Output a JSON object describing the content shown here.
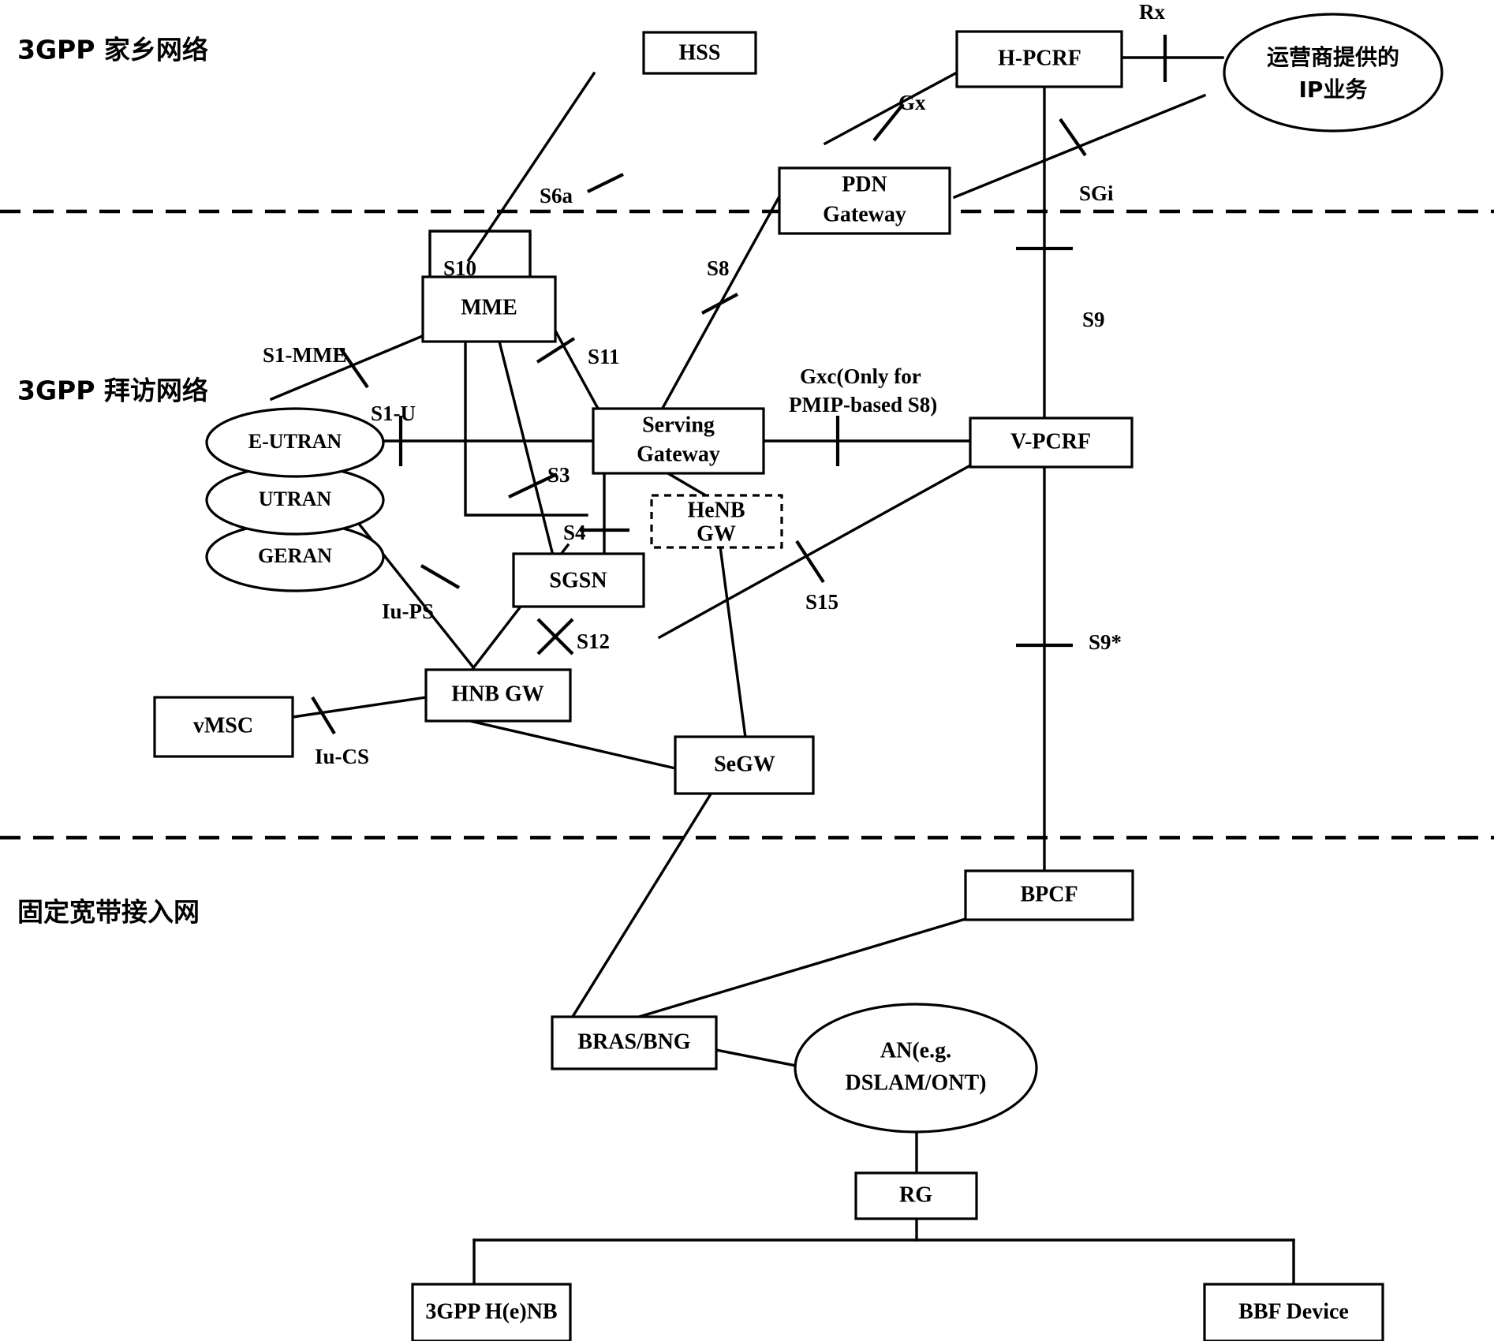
{
  "diagram": {
    "title": "3GPP EPS and Fixed Broadband Access Network Architecture",
    "zones": [
      {
        "id": "home",
        "label": "3GPP 家乡网络"
      },
      {
        "id": "visited",
        "label": "3GPP 拜访网络"
      },
      {
        "id": "fixed",
        "label": "固定宽带接入网"
      }
    ],
    "nodes": {
      "hss": {
        "label": "HSS"
      },
      "hpcrf": {
        "label": "H-PCRF"
      },
      "ipservices": {
        "label_line1": "运营商提供的",
        "label_line2": "IP业务"
      },
      "pdngw": {
        "label_line1": "PDN",
        "label_line2": "Gateway"
      },
      "mme": {
        "label": "MME"
      },
      "eutran": {
        "label": "E-UTRAN"
      },
      "utran": {
        "label": "UTRAN"
      },
      "geran": {
        "label": "GERAN"
      },
      "sgw": {
        "label_line1": "Serving",
        "label_line2": "Gateway"
      },
      "henbgw": {
        "label_line1": "HeNB",
        "label_line2": "GW"
      },
      "vpcrf": {
        "label": "V-PCRF"
      },
      "sgsn": {
        "label": "SGSN"
      },
      "hnbgw": {
        "label": "HNB GW"
      },
      "vmsc": {
        "label": "vMSC"
      },
      "segw": {
        "label": "SeGW"
      },
      "bpcf": {
        "label": "BPCF"
      },
      "brasbng": {
        "label": "BRAS/BNG"
      },
      "an": {
        "label_line1": "AN(e.g.",
        "label_line2": "DSLAM/ONT)"
      },
      "rg": {
        "label": "RG"
      },
      "henb3gpp": {
        "label": "3GPP H(e)NB"
      },
      "bbfdevice": {
        "label": "BBF Device"
      }
    },
    "interfaces": {
      "rx": "Rx",
      "gx": "Gx",
      "sgi": "SGi",
      "s6a": "S6a",
      "s8": "S8",
      "s10": "S10",
      "s1mme": "S1-MME",
      "s1u": "S1-U",
      "s11": "S11",
      "s9": "S9",
      "gxc": "Gxc(Only for",
      "gxc2": "PMIP-based S8)",
      "s3": "S3",
      "s4": "S4",
      "s12": "S12",
      "s15": "S15",
      "s9star": "S9*",
      "iups": "Iu-PS",
      "iucs": "Iu-CS"
    },
    "colors": {
      "stroke": "#000000",
      "fill": "#ffffff"
    }
  }
}
